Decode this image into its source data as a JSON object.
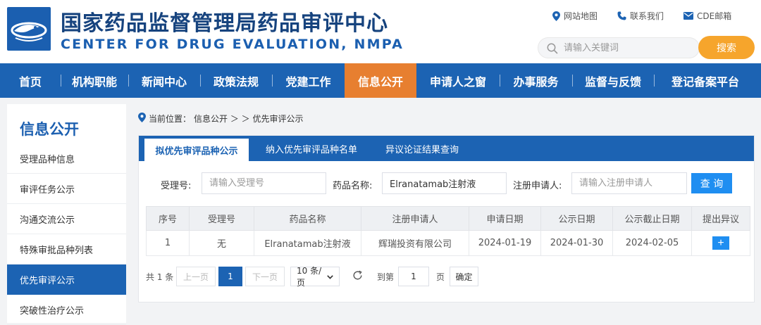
{
  "header": {
    "title_cn": "国家药品监督管理局药品审评中心",
    "title_en": "CENTER FOR DRUG EVALUATION, NMPA",
    "links": [
      "网站地图",
      "联系我们",
      "CDE邮箱"
    ],
    "search": {
      "placeholder": "请输入关键词",
      "button": "搜索"
    }
  },
  "nav": {
    "items": [
      "首页",
      "机构职能",
      "新闻中心",
      "政策法规",
      "党建工作",
      "信息公开",
      "申请人之窗",
      "办事服务",
      "监督与反馈",
      "登记备案平台"
    ],
    "active": "信息公开"
  },
  "sidebar": {
    "title": "信息公开",
    "items": [
      "受理品种信息",
      "审评任务公示",
      "沟通交流公示",
      "特殊审批品种列表",
      "优先审评公示",
      "突破性治疗公示"
    ],
    "active": "优先审评公示"
  },
  "breadcrumb": {
    "prefix": "当前位置：",
    "path": "信息公开 ＞ ＞ 优先审评公示"
  },
  "tabs": [
    "拟优先审评品种公示",
    "纳入优先审评品种名单",
    "异议论证结果查询"
  ],
  "filter": {
    "accept_label": "受理号:",
    "accept_placeholder": "请输入受理号",
    "drug_label": "药品名称:",
    "drug_value": "Elranatamab注射液",
    "applicant_label": "注册申请人:",
    "applicant_placeholder": "请输入注册申请人",
    "query_button": "查 询"
  },
  "table": {
    "headers": [
      "序号",
      "受理号",
      "药品名称",
      "注册申请人",
      "申请日期",
      "公示日期",
      "公示截止日期",
      "提出异议"
    ],
    "rows": [
      [
        "1",
        "无",
        "Elranatamab注射液",
        "辉瑞投资有限公司",
        "2024-01-19",
        "2024-01-30",
        "2024-02-05",
        "+"
      ]
    ]
  },
  "pager": {
    "total": "共 1 条",
    "prev": "上一页",
    "page": "1",
    "next": "下一页",
    "page_size": "10 条/页",
    "goto_label": "到第",
    "goto_value": "1",
    "page_unit": "页",
    "confirm": "确定"
  },
  "colors": {
    "brand_blue": "#1c63b3",
    "active_orange": "#e77f30",
    "search_orange": "#f6a52c",
    "button_blue": "#1f8ef1"
  }
}
